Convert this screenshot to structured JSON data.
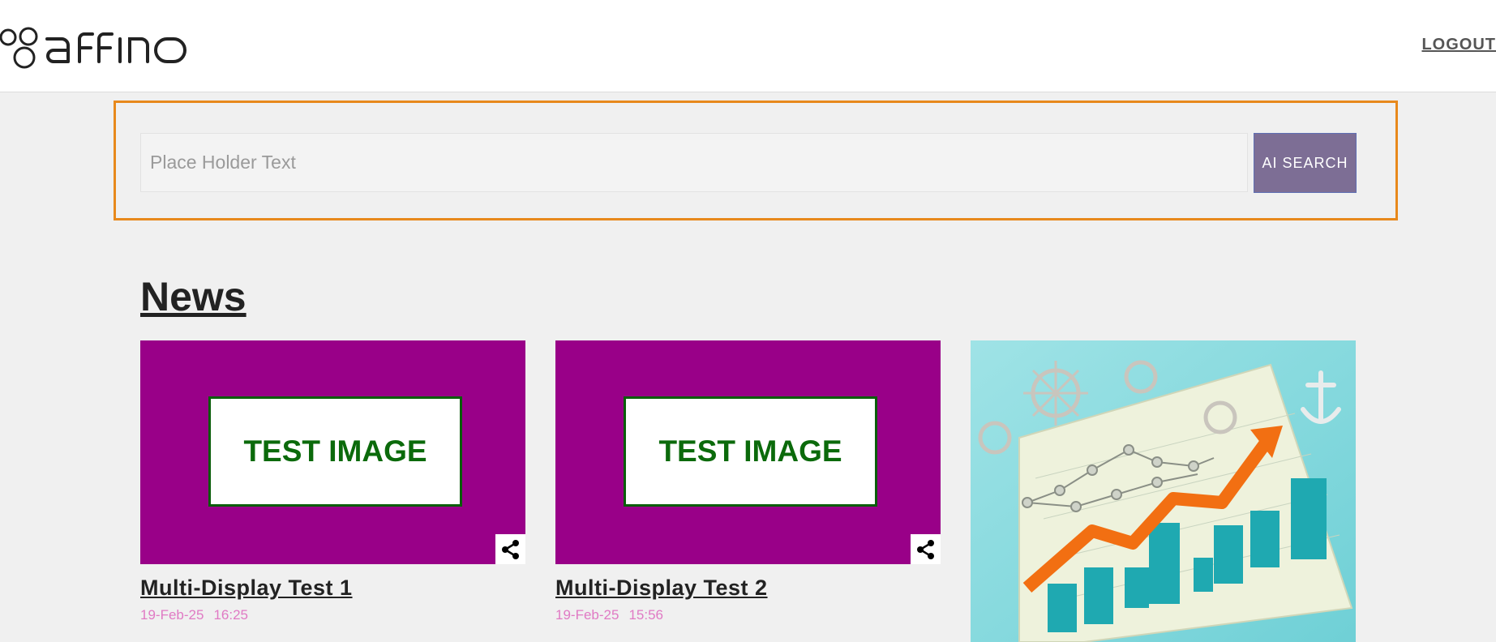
{
  "header": {
    "logo_text": "affino",
    "logout_label": "LOGOUT"
  },
  "search": {
    "placeholder": "Place Holder Text",
    "value": "",
    "button_label": "AI SEARCH"
  },
  "news": {
    "title": "News",
    "cards": [
      {
        "image_text": "TEST IMAGE",
        "title": "Multi-Display Test 1",
        "date": "19-Feb-25",
        "time": "16:25"
      },
      {
        "image_text": "TEST IMAGE",
        "title": "Multi-Display Test 2",
        "date": "19-Feb-25",
        "time": "15:56"
      }
    ]
  },
  "colors": {
    "search_border": "#e8891c",
    "ai_button_bg": "#7d6e95",
    "test_image_bg": "#990088",
    "test_image_text": "#0b6a0b",
    "date_text": "#e07ac4"
  },
  "icons": {
    "share": "share-icon"
  }
}
